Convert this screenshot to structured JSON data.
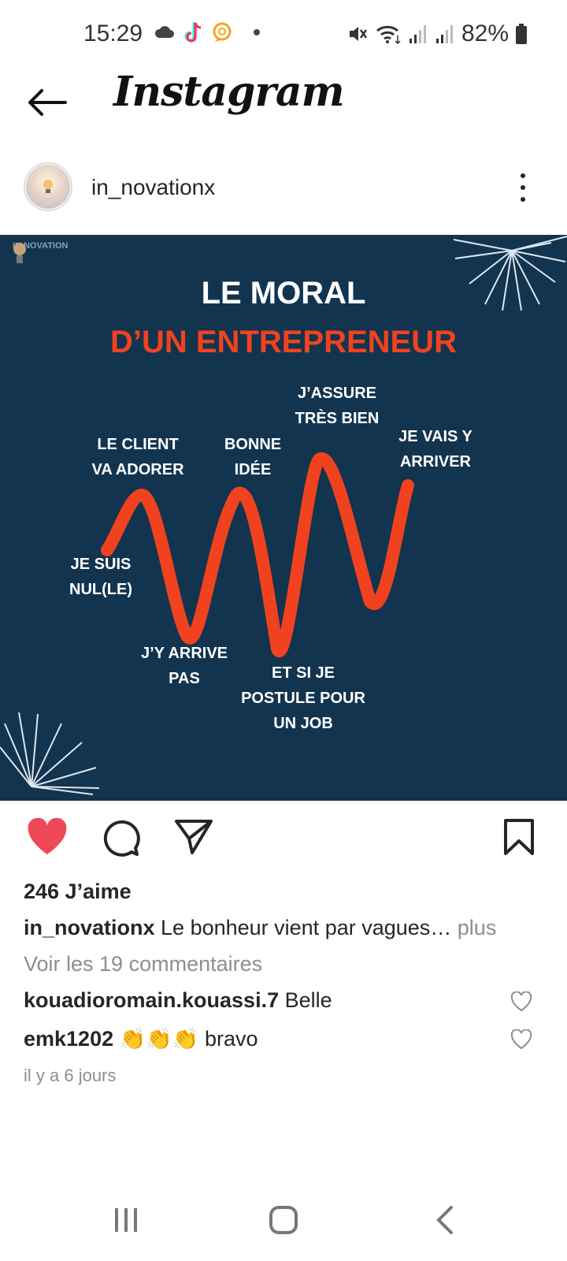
{
  "status_bar": {
    "time": "15:29",
    "battery_pct": "82%",
    "left_icons": [
      "cloud-icon",
      "tiktok-icon",
      "chat-bubble-icon",
      "dot-icon"
    ],
    "right_icons": [
      "mute-icon",
      "wifi-icon",
      "signal-icon",
      "signal-icon",
      "battery-icon"
    ]
  },
  "header": {
    "title": "Instagram"
  },
  "post": {
    "username": "in_novationx",
    "image": {
      "logo_text": "IN NOVATION",
      "title_line1": "LE MORAL",
      "title_line2": "D’UN ENTREPRENEUR",
      "labels": {
        "nul": "JE SUIS\nNUL(LE)",
        "client": "LE CLIENT\nVA ADORER",
        "arrive_pas": "J’Y ARRIVE\nPAS",
        "bonne_idee": "BONNE\nIDÉE",
        "postule": "ET SI JE\nPOSTULE POUR\nUN JOB",
        "assure": "J’ASSURE\nTRÈS BIEN",
        "vais_arriver": "JE VAIS Y\nARRIVER"
      },
      "colors": {
        "background": "#12344f",
        "accent": "#f0421f"
      }
    },
    "likes": "246 J’aime",
    "caption": {
      "username": "in_novationx",
      "text": " Le bonheur vient par vagues…",
      "more": " plus"
    },
    "view_comments": "Voir les 19 commentaires",
    "comments": [
      {
        "username": "kouadioromain.kouassi.7",
        "text": " Belle"
      },
      {
        "username": "emk1202",
        "text": " 👏👏👏 bravo"
      }
    ],
    "timestamp": "il y a 6 jours"
  },
  "colors": {
    "like_red": "#ed4956"
  }
}
